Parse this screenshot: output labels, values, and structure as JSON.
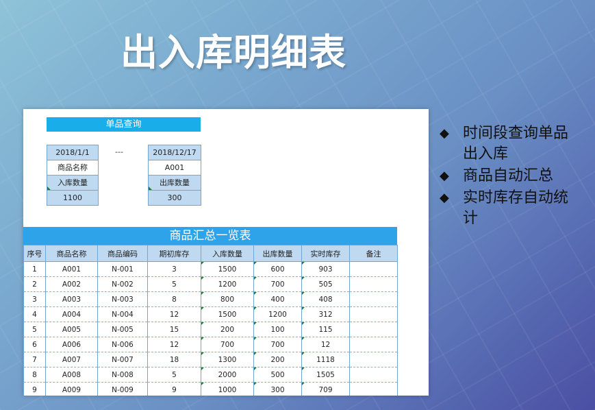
{
  "slide": {
    "title": "出入库明细表",
    "bullets": [
      "时间段查询单品出入库",
      "商品自动汇总",
      "实时库存自动统计"
    ]
  },
  "query": {
    "header": "单品查询",
    "start_date": "2018/1/1",
    "separator": "---",
    "end_date": "2018/12/17",
    "product_name_label": "商品名称",
    "product_name_value": "A001",
    "in_qty_label": "入库数量",
    "in_qty_value": "1100",
    "out_qty_label": "出库数量",
    "out_qty_value": "300"
  },
  "summary": {
    "title": "商品汇总一览表",
    "columns": [
      "序号",
      "商品名称",
      "商品编码",
      "期初库存",
      "入库数量",
      "出库数量",
      "实时库存",
      "备注"
    ],
    "rows": [
      [
        "1",
        "A001",
        "N-001",
        "3",
        "1500",
        "600",
        "903",
        ""
      ],
      [
        "2",
        "A002",
        "N-002",
        "5",
        "1200",
        "700",
        "505",
        ""
      ],
      [
        "3",
        "A003",
        "N-003",
        "8",
        "800",
        "400",
        "408",
        ""
      ],
      [
        "4",
        "A004",
        "N-004",
        "12",
        "1500",
        "1200",
        "312",
        ""
      ],
      [
        "5",
        "A005",
        "N-005",
        "15",
        "200",
        "100",
        "115",
        ""
      ],
      [
        "6",
        "A006",
        "N-006",
        "12",
        "700",
        "700",
        "12",
        ""
      ],
      [
        "7",
        "A007",
        "N-007",
        "18",
        "1300",
        "200",
        "1118",
        ""
      ],
      [
        "8",
        "A008",
        "N-008",
        "5",
        "2000",
        "500",
        "1505",
        ""
      ],
      [
        "9",
        "A009",
        "N-009",
        "9",
        "1000",
        "300",
        "709",
        ""
      ]
    ]
  },
  "colors": {
    "header_blue": "#19aeea",
    "cell_shade": "#bfd9f0",
    "grid_line": "#6fa6d6"
  }
}
